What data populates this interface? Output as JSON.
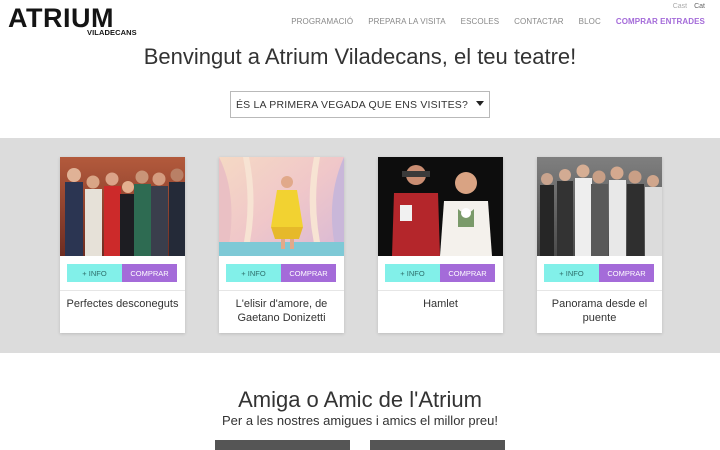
{
  "header": {
    "logo_main": "ATRIUM",
    "logo_sub": "VILADECANS",
    "languages": [
      {
        "label": "Cast",
        "active": false
      },
      {
        "label": "Cat",
        "active": true
      }
    ],
    "nav": [
      {
        "label": "PROGRAMACIÓ"
      },
      {
        "label": "PREPARA LA VISITA"
      },
      {
        "label": "ESCOLES"
      },
      {
        "label": "CONTACTAR"
      },
      {
        "label": "BLOC"
      },
      {
        "label": "COMPRAR ENTRADES"
      }
    ]
  },
  "welcome": {
    "title": "Benvingut a Atrium Viladecans, el teu teatre!",
    "first_visit_label": "ÉS LA PRIMERA VEGADA QUE ENS VISITES?"
  },
  "shows": [
    {
      "title": "Perfectes desconeguts",
      "info_label": "+ INFO",
      "buy_label": "COMPRAR"
    },
    {
      "title": "L'elisir d'amore, de Gaetano Donizetti",
      "info_label": "+ INFO",
      "buy_label": "COMPRAR"
    },
    {
      "title": "Hamlet",
      "info_label": "+ INFO",
      "buy_label": "COMPRAR"
    },
    {
      "title": "Panorama desde el puente",
      "info_label": "+ INFO",
      "buy_label": "COMPRAR"
    }
  ],
  "amic": {
    "title": "Amiga o Amic de l'Atrium",
    "subtitle": "Per a les nostres amigues i amics el millor preu!"
  },
  "colors": {
    "accent": "#a46bd9",
    "info": "#82f0e9",
    "band": "#dcdcdc"
  }
}
